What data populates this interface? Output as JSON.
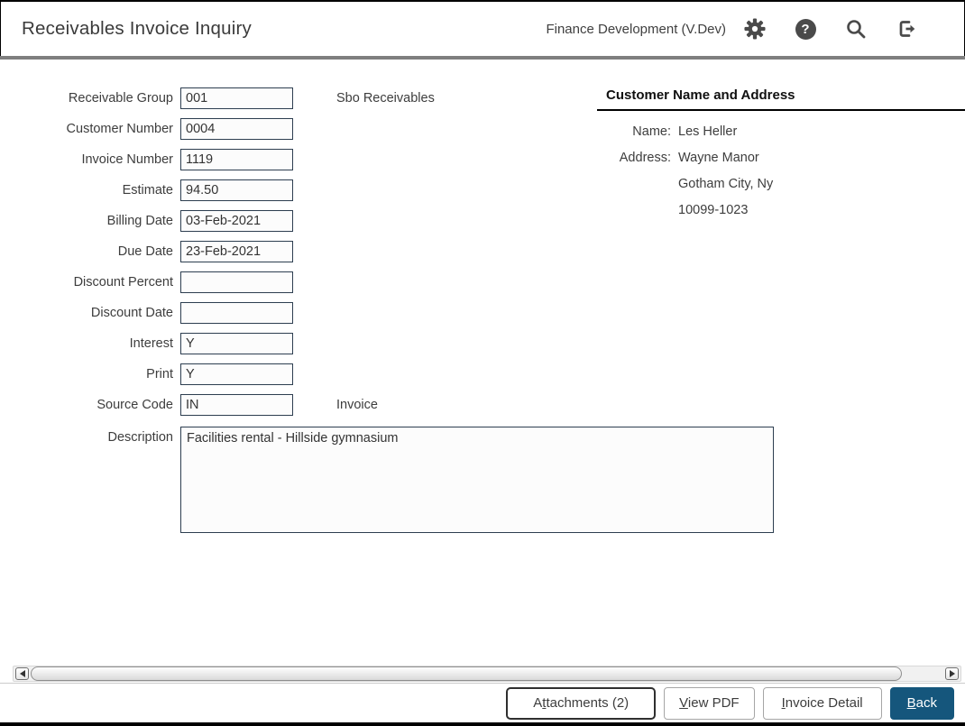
{
  "header": {
    "title": "Receivables Invoice Inquiry",
    "environment": "Finance Development (V.Dev)",
    "icons": {
      "help_glyph": "?"
    }
  },
  "form": {
    "fields": [
      {
        "label": "Receivable Group",
        "value": "001",
        "suffix": "Sbo Receivables"
      },
      {
        "label": "Customer Number",
        "value": "0004",
        "suffix": ""
      },
      {
        "label": "Invoice Number",
        "value": "1119",
        "suffix": ""
      },
      {
        "label": "Estimate",
        "value": "94.50",
        "suffix": ""
      },
      {
        "label": "Billing Date",
        "value": "03-Feb-2021",
        "suffix": ""
      },
      {
        "label": "Due Date",
        "value": "23-Feb-2021",
        "suffix": ""
      },
      {
        "label": "Discount Percent",
        "value": "",
        "suffix": ""
      },
      {
        "label": "Discount Date",
        "value": "",
        "suffix": ""
      },
      {
        "label": "Interest",
        "value": "Y",
        "suffix": ""
      },
      {
        "label": "Print",
        "value": "Y",
        "suffix": ""
      },
      {
        "label": "Source Code",
        "value": "IN",
        "suffix": "Invoice"
      }
    ],
    "description": {
      "label": "Description",
      "value": "Facilities rental - Hillside gymnasium"
    }
  },
  "customer_panel": {
    "title": "Customer Name and Address",
    "name_label": "Name:",
    "name": "Les Heller",
    "address_label": "Address:",
    "address_line1": "Wayne Manor",
    "address_line2": "Gotham City, Ny",
    "address_line3": "10099-1023"
  },
  "footer": {
    "buttons": [
      {
        "label": "Attachments (2)",
        "access_key": "t"
      },
      {
        "label": "View PDF",
        "access_key": "V"
      },
      {
        "label": "Invoice Detail",
        "access_key": "I"
      },
      {
        "label": "Back",
        "access_key": "B"
      }
    ]
  },
  "colors": {
    "primary_button": "#15567c",
    "header_divider": "#7f7f7f",
    "input_border": "#2d3e50",
    "icon": "#4a4a4a"
  }
}
